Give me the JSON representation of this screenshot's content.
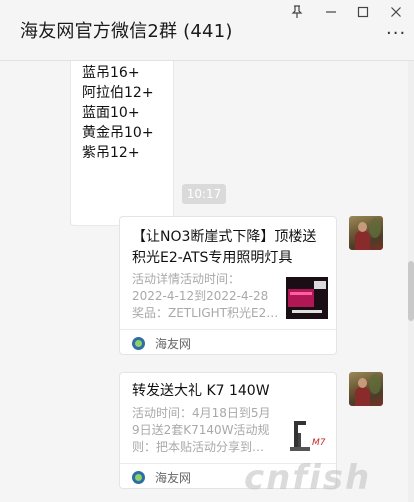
{
  "window": {
    "title": "海友网官方微信2群 (441)",
    "controls": {
      "pin": "⊥",
      "minimize": "—",
      "maximize": "☐",
      "close": "✕"
    },
    "more": "···"
  },
  "messages": {
    "list_bubble": {
      "lines": [
        "蓝吊16+",
        "阿拉伯12+",
        "蓝面10+",
        "黄金吊10+",
        "紫吊12+"
      ]
    },
    "timestamp": "10:17",
    "cards": [
      {
        "title": "【让NO3断崖式下降】顶楼送积光E2-ATS专用照明灯具",
        "desc": [
          "活动详情活动时间：",
          "2022-4-12到2022-4-28",
          "奖品：ZETLIGHT积光E2…"
        ],
        "source": "海友网",
        "thumb_text": "积光照明活动"
      },
      {
        "title": "转发送大礼 K7 140W",
        "desc": [
          "活动时间：4月18日到5月",
          "9日送2套K7140W活动规",
          "则：把本贴活动分享到…"
        ],
        "source": "海友网",
        "thumb_text": "K7"
      }
    ]
  },
  "watermark": "cnfish",
  "colors": {
    "background": "#f5f5f5",
    "bubble": "#ffffff",
    "timestamp_bg": "#dadada",
    "desc_text": "#a9a9a9"
  }
}
